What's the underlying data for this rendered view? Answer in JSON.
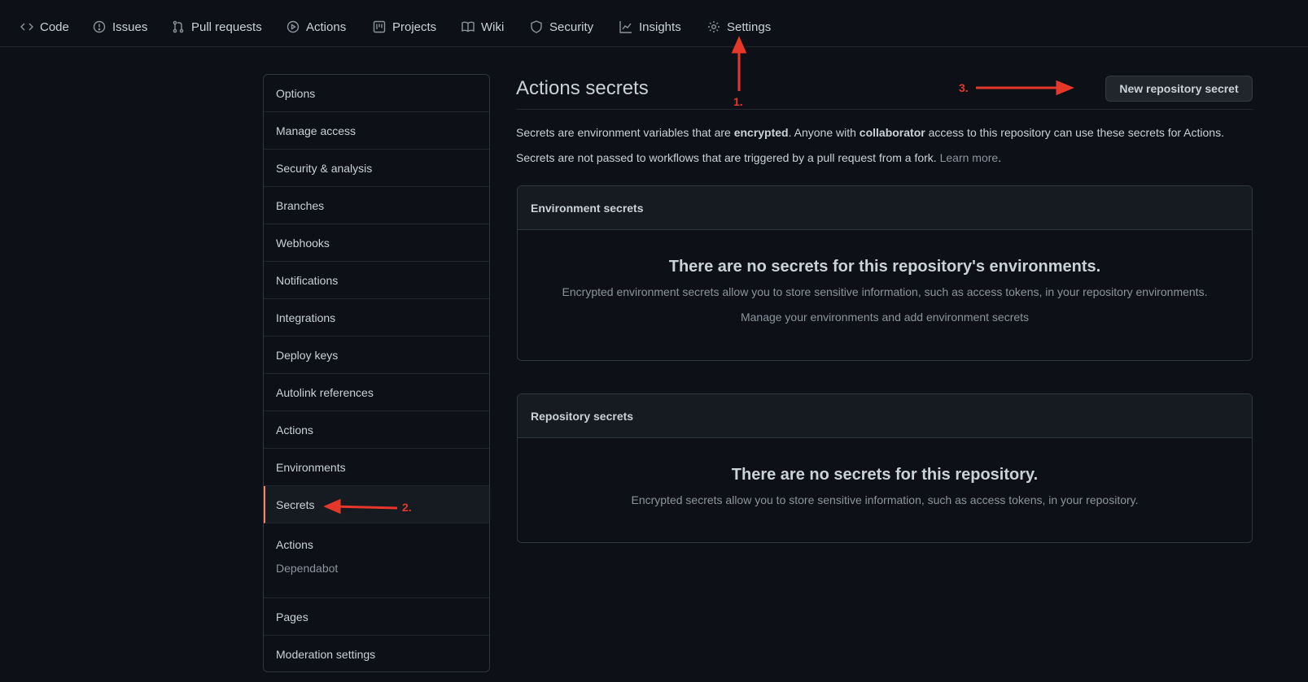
{
  "nav": {
    "items": [
      {
        "label": "Code",
        "icon": "code-icon"
      },
      {
        "label": "Issues",
        "icon": "issue-icon"
      },
      {
        "label": "Pull requests",
        "icon": "pull-request-icon"
      },
      {
        "label": "Actions",
        "icon": "play-icon"
      },
      {
        "label": "Projects",
        "icon": "project-icon"
      },
      {
        "label": "Wiki",
        "icon": "book-icon"
      },
      {
        "label": "Security",
        "icon": "shield-icon"
      },
      {
        "label": "Insights",
        "icon": "graph-icon"
      },
      {
        "label": "Settings",
        "icon": "gear-icon"
      }
    ]
  },
  "sidebar": {
    "items": [
      {
        "label": "Options"
      },
      {
        "label": "Manage access"
      },
      {
        "label": "Security & analysis"
      },
      {
        "label": "Branches"
      },
      {
        "label": "Webhooks"
      },
      {
        "label": "Notifications"
      },
      {
        "label": "Integrations"
      },
      {
        "label": "Deploy keys"
      },
      {
        "label": "Autolink references"
      },
      {
        "label": "Actions"
      },
      {
        "label": "Environments"
      },
      {
        "label": "Secrets",
        "selected": true
      }
    ],
    "secrets_group": {
      "heading": "Actions",
      "sub": "Dependabot"
    },
    "bottom_items": [
      {
        "label": "Pages"
      },
      {
        "label": "Moderation settings"
      }
    ]
  },
  "main": {
    "title": "Actions secrets",
    "new_button": "New repository secret",
    "desc1": {
      "a": "Secrets are environment variables that are ",
      "b": "encrypted",
      "c": ". Anyone with ",
      "d": "collaborator",
      "e": " access to this repository can use these secrets for Actions."
    },
    "desc2": {
      "a": "Secrets are not passed to workflows that are triggered by a pull request from a fork. ",
      "link": "Learn more",
      "b": "."
    },
    "env_box": {
      "header": "Environment secrets",
      "title": "There are no secrets for this repository's environments.",
      "text": "Encrypted environment secrets allow you to store sensitive information, such as access tokens, in your repository environments.",
      "link": "Manage your environments and add environment secrets"
    },
    "repo_box": {
      "header": "Repository secrets",
      "title": "There are no secrets for this repository.",
      "text": "Encrypted secrets allow you to store sensitive information, such as access tokens, in your repository."
    }
  },
  "annotations": {
    "one": "1.",
    "two": "2.",
    "three": "3.",
    "color": "#e5382a"
  },
  "colors": {
    "bg": "#0d1117",
    "border": "#30363d",
    "box_head": "#161b22",
    "selected_accent": "#f78166"
  }
}
